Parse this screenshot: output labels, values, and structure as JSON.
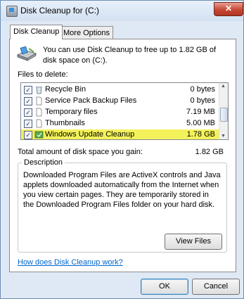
{
  "window": {
    "title": "Disk Cleanup for  (C:)",
    "close_glyph": "✕"
  },
  "tabs": [
    {
      "label": "Disk Cleanup",
      "active": true
    },
    {
      "label": "More Options",
      "active": false
    }
  ],
  "info_text": "You can use Disk Cleanup to free up to 1.82 GB of disk space on  (C:).",
  "files_label": "Files to delete:",
  "files": [
    {
      "name": "Recycle Bin",
      "size": "0 bytes",
      "checked": true,
      "icon": "recycle-bin-icon"
    },
    {
      "name": "Service Pack Backup Files",
      "size": "0 bytes",
      "checked": true,
      "icon": "file-icon"
    },
    {
      "name": "Temporary files",
      "size": "7.19 MB",
      "checked": true,
      "icon": "file-icon"
    },
    {
      "name": "Thumbnails",
      "size": "5.00 MB",
      "checked": true,
      "icon": "file-icon"
    },
    {
      "name": "Windows Update Cleanup",
      "size": "1.78 GB",
      "checked": true,
      "icon": "update-icon",
      "highlighted": true
    }
  ],
  "total": {
    "label": "Total amount of disk space you gain:",
    "value": "1.82 GB"
  },
  "description": {
    "title": "Description",
    "text": "Downloaded Program Files are ActiveX controls and Java applets downloaded automatically from the Internet when you view certain pages. They are temporarily stored in the Downloaded Program Files folder on your hard disk."
  },
  "buttons": {
    "view_files": "View Files",
    "ok": "OK",
    "cancel": "Cancel"
  },
  "help_link": "How does Disk Cleanup work?",
  "colors": {
    "highlight": "#f4f25a",
    "link": "#0066cc",
    "close_button": "#c74634"
  }
}
